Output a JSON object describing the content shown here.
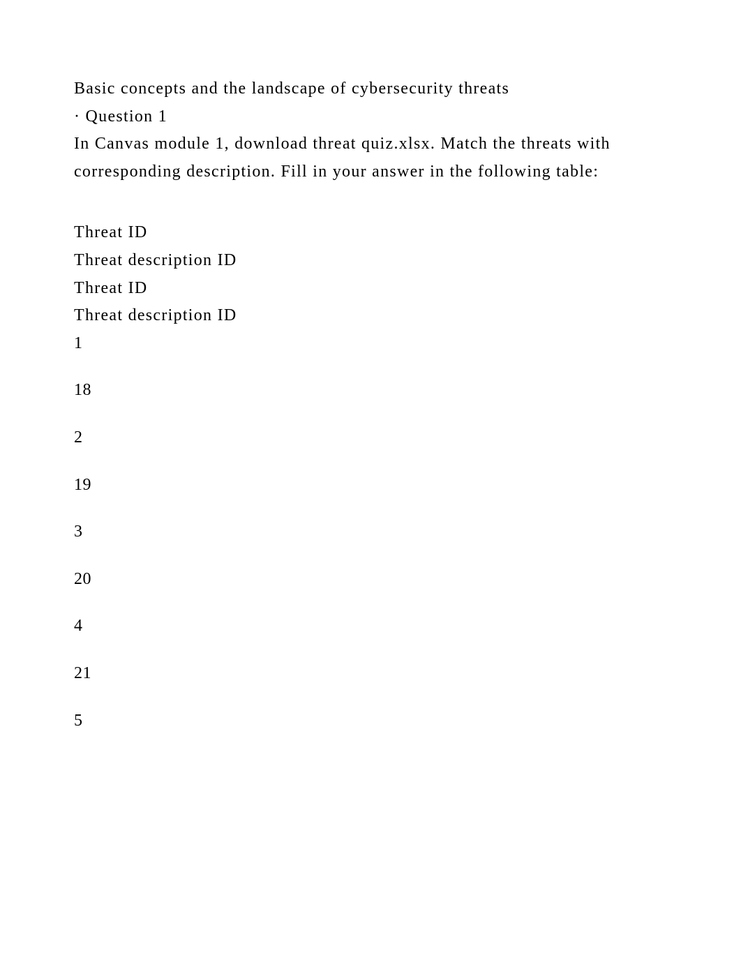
{
  "intro": {
    "title": "Basic concepts and the landscape of cybersecurity threats",
    "question_label": "· Question 1",
    "instructions": "In Canvas module 1, download threat quiz.xlsx. Match the threats with corresponding description. Fill in your answer in the following table:"
  },
  "headers": [
    "Threat ID",
    "Threat description ID",
    "Threat ID",
    "Threat description ID"
  ],
  "numbers": [
    "1",
    "18",
    "2",
    "19",
    "3",
    "20",
    "4",
    "21",
    "5"
  ]
}
